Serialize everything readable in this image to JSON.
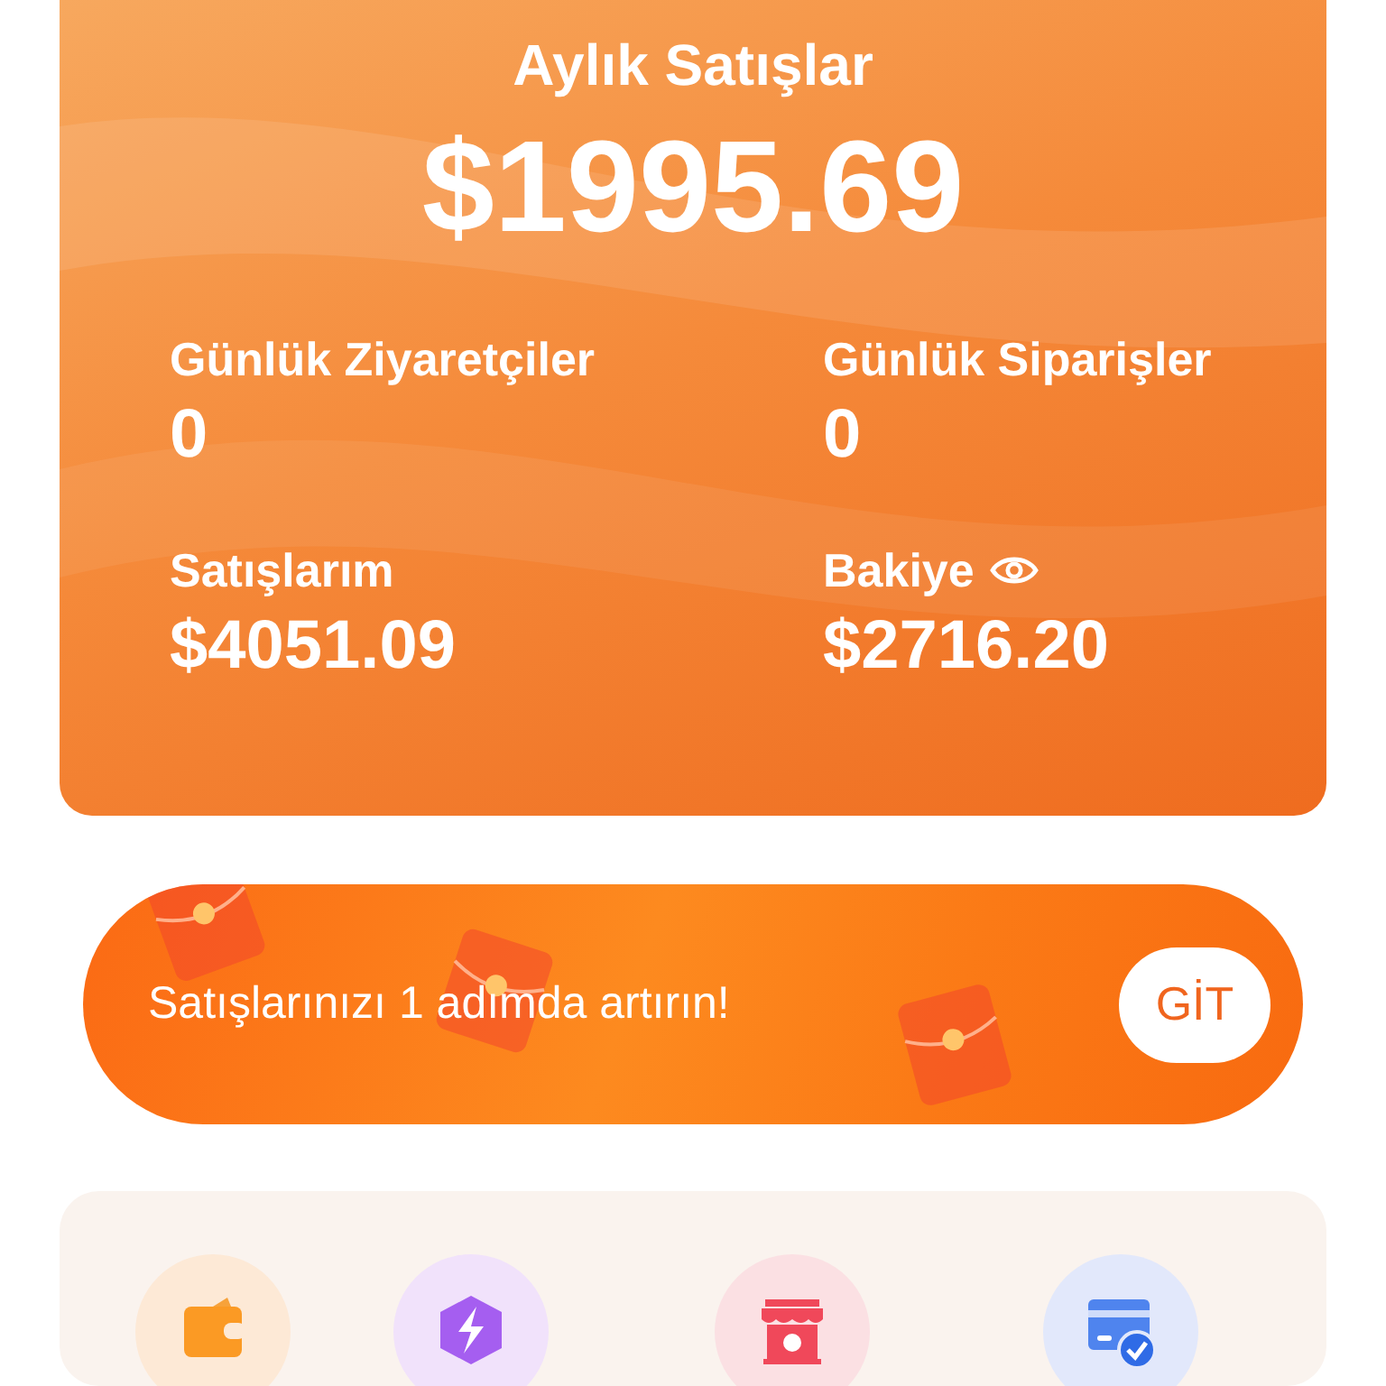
{
  "summary": {
    "title": "Aylık Satışlar",
    "amount": "$1995.69",
    "stats": [
      {
        "label": "Günlük Ziyaretçiler",
        "value": "0"
      },
      {
        "label": "Günlük Siparişler",
        "value": "0"
      },
      {
        "label": "Satışlarım",
        "value": "$4051.09"
      },
      {
        "label": "Bakiye",
        "value": "$2716.20",
        "kind": "toggle"
      }
    ]
  },
  "banner": {
    "text": "Satışlarınızı 1 adımda artırın!",
    "button": "GİT"
  },
  "shortcuts": [
    {
      "kind": "wallet"
    },
    {
      "kind": "bolt"
    },
    {
      "kind": "store"
    },
    {
      "kind": "card"
    }
  ]
}
